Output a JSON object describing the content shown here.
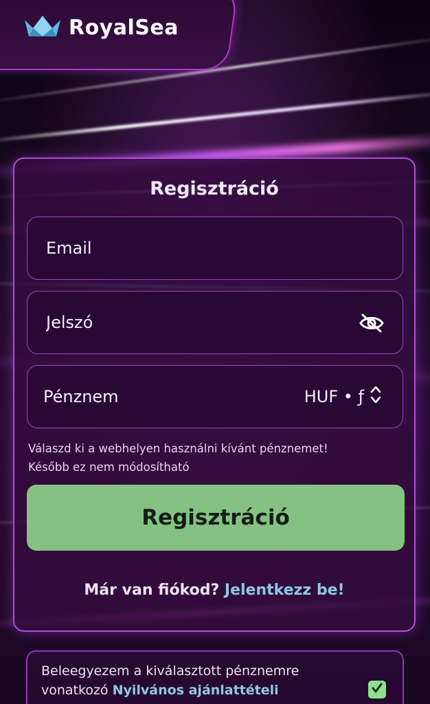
{
  "brand": {
    "name": "RoyalSea",
    "logo_icon": "crown-icon"
  },
  "colors": {
    "card_border": "#b04ed6",
    "card_bg": "#340c3e",
    "submit_bg": "#86c184",
    "link": "#8fc7e6",
    "checkbox": "#8ee08b"
  },
  "form": {
    "title": "Regisztráció",
    "email_placeholder": "Email",
    "password_placeholder": "Jelszó",
    "password_toggle_icon": "eye-off-icon",
    "currency_label": "Pénznem",
    "currency_value": "HUF • ƒ",
    "currency_icon": "chevron-up-down-icon",
    "hint_line1": "Válaszd ki a webhelyen használni kívánt pénznemet!",
    "hint_line2": "Később ez nem módosítható",
    "submit_label": "Regisztráció",
    "login_prompt": "Már van fiókod? ",
    "login_link": "Jelentkezz be!"
  },
  "consent": {
    "text_before": "Beleegyezem a kiválasztott pénznemre vonatkozó ",
    "link_text": "Nyilvános ajánlattételi",
    "checked": true,
    "check_icon": "checkmark-icon"
  }
}
